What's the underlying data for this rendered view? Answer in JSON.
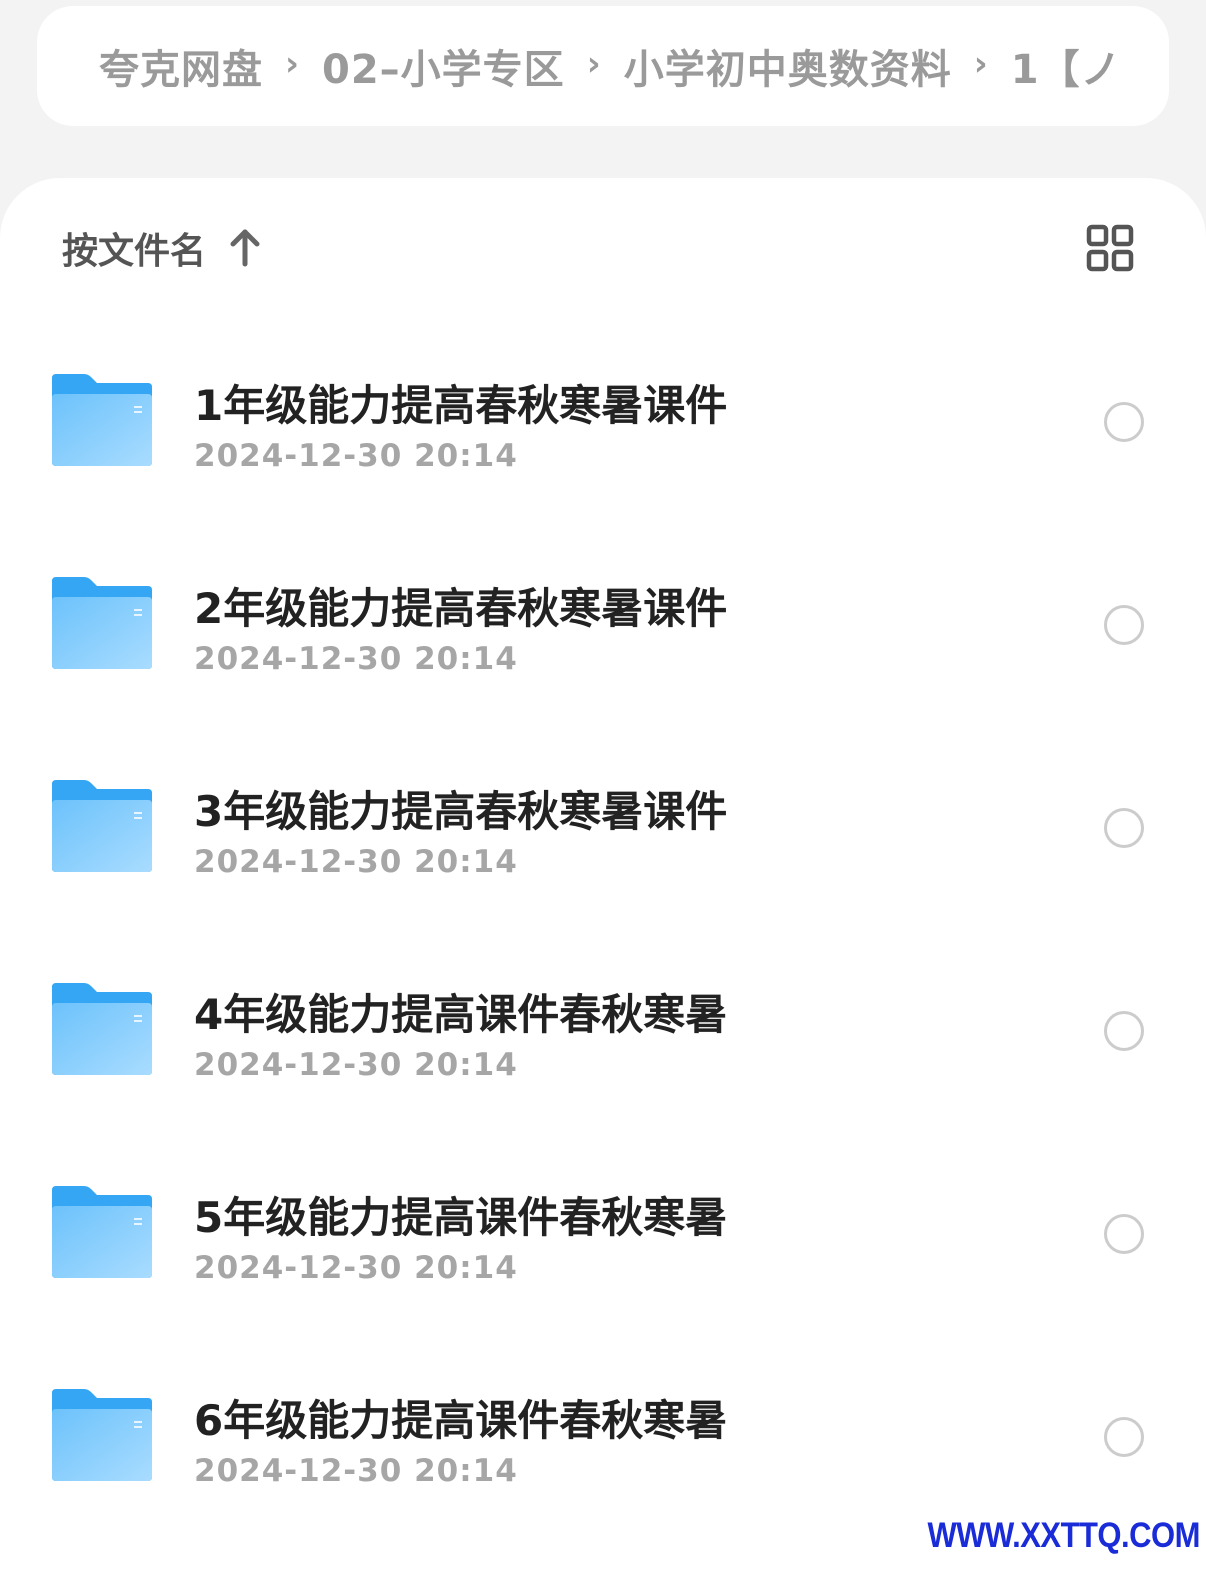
{
  "breadcrumb": {
    "items": [
      "夸克网盘",
      "02–小学专区",
      "小学初中奥数资料",
      "1【ノ"
    ],
    "separator": "›"
  },
  "sort": {
    "label": "按文件名",
    "direction_icon": "arrow-up-icon"
  },
  "view_toggle": {
    "icon": "grid-view-icon"
  },
  "files": [
    {
      "name": "1年级能力提高春秋寒暑课件",
      "date": "2024-12-30 20:14",
      "icon": "folder-icon"
    },
    {
      "name": "2年级能力提高春秋寒暑课件",
      "date": "2024-12-30 20:14",
      "icon": "folder-icon"
    },
    {
      "name": "3年级能力提高春秋寒暑课件",
      "date": "2024-12-30 20:14",
      "icon": "folder-icon"
    },
    {
      "name": "4年级能力提高课件春秋寒暑",
      "date": "2024-12-30 20:14",
      "icon": "folder-icon"
    },
    {
      "name": "5年级能力提高课件春秋寒暑",
      "date": "2024-12-30 20:14",
      "icon": "folder-icon"
    },
    {
      "name": "6年级能力提高课件春秋寒暑",
      "date": "2024-12-30 20:14",
      "icon": "folder-icon"
    }
  ],
  "watermark": "WWW.XXTTQ.COM",
  "colors": {
    "background": "#f3f3f3",
    "folder_blue": "#4db3f5",
    "folder_light": "#a8dbff",
    "text_primary": "#222222",
    "text_secondary": "#a6a6a6",
    "watermark": "#1a2bd8"
  }
}
